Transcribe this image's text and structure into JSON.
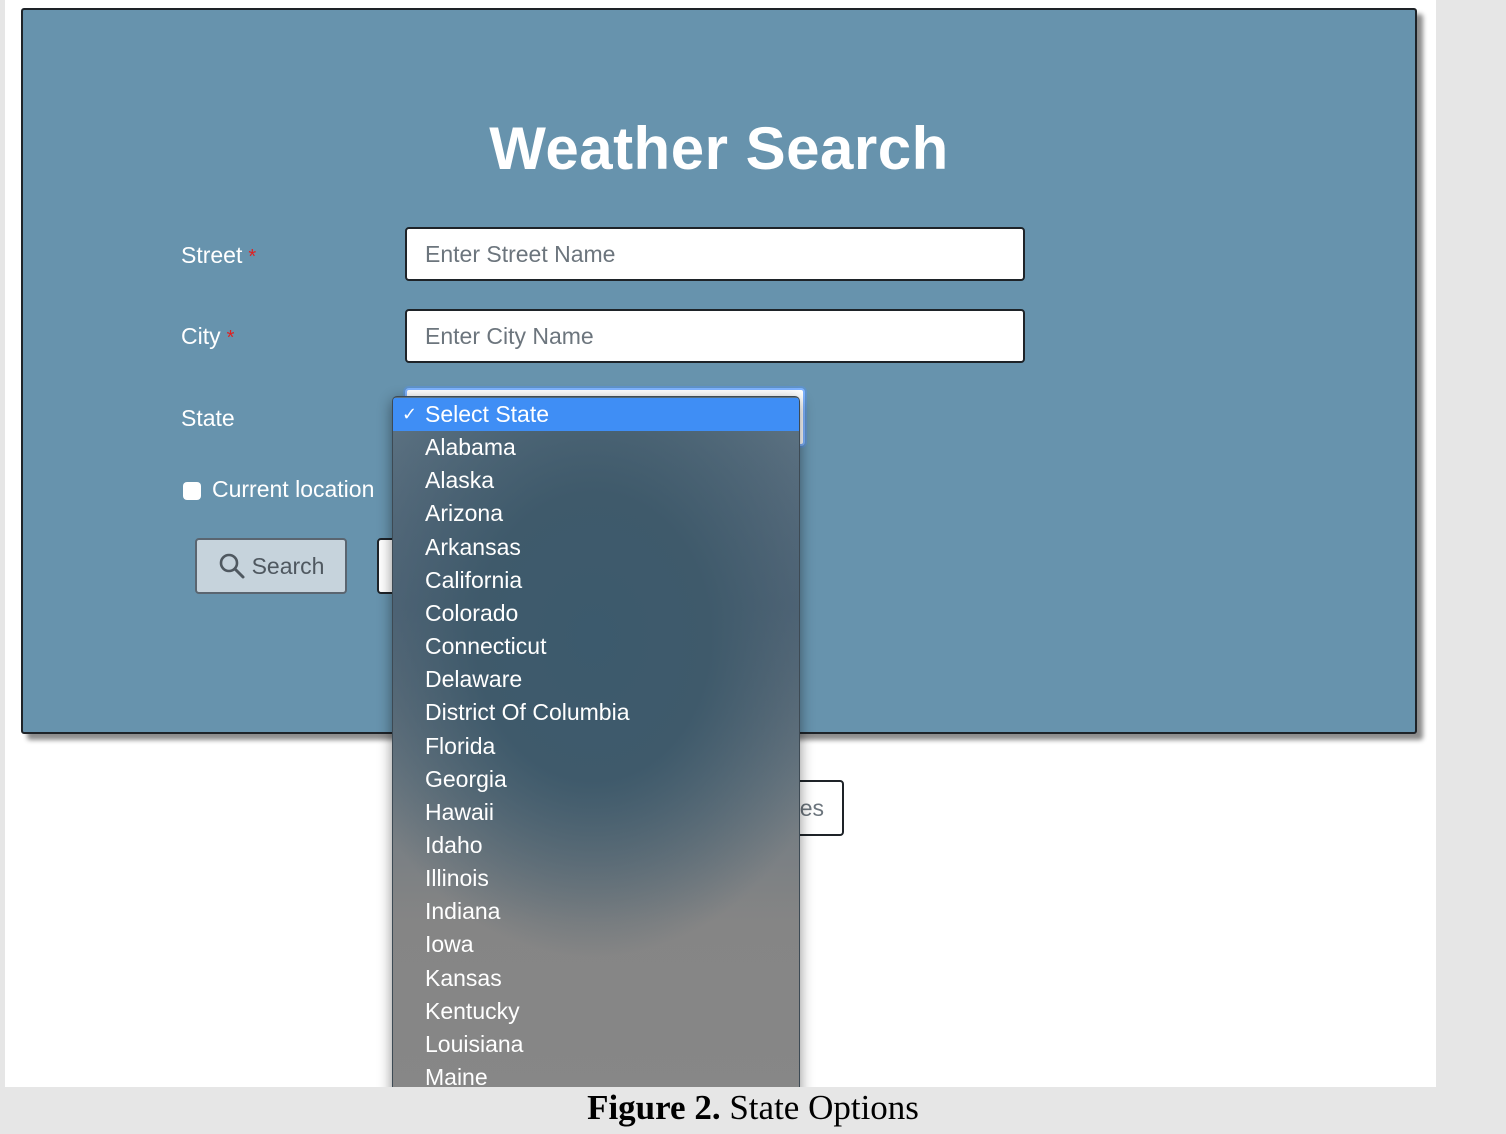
{
  "page": {
    "title": "Weather Search"
  },
  "form": {
    "street": {
      "label": "Street",
      "required_mark": "*",
      "placeholder": "Enter Street Name"
    },
    "city": {
      "label": "City",
      "required_mark": "*",
      "placeholder": "Enter City Name"
    },
    "state": {
      "label": "State",
      "selected": "Select State"
    },
    "current_location": {
      "label": "Current location",
      "checked": false
    },
    "search_button": {
      "label": "Search",
      "icon": "search-icon"
    },
    "favorites_button": {
      "visible_text": "tes"
    }
  },
  "state_dropdown": {
    "checkmark": "✓",
    "options": [
      "Select State",
      "Alabama",
      "Alaska",
      "Arizona",
      "Arkansas",
      "California",
      "Colorado",
      "Connecticut",
      "Delaware",
      "District Of Columbia",
      "Florida",
      "Georgia",
      "Hawaii",
      "Idaho",
      "Illinois",
      "Indiana",
      "Iowa",
      "Kansas",
      "Kentucky",
      "Louisiana",
      "Maine"
    ],
    "selected_index": 0
  },
  "caption": {
    "prefix": "Figure 2.",
    "text": " State Options"
  },
  "colors": {
    "card_background": "#6793ad",
    "highlight": "#3f8ef5",
    "required": "#e02020"
  }
}
